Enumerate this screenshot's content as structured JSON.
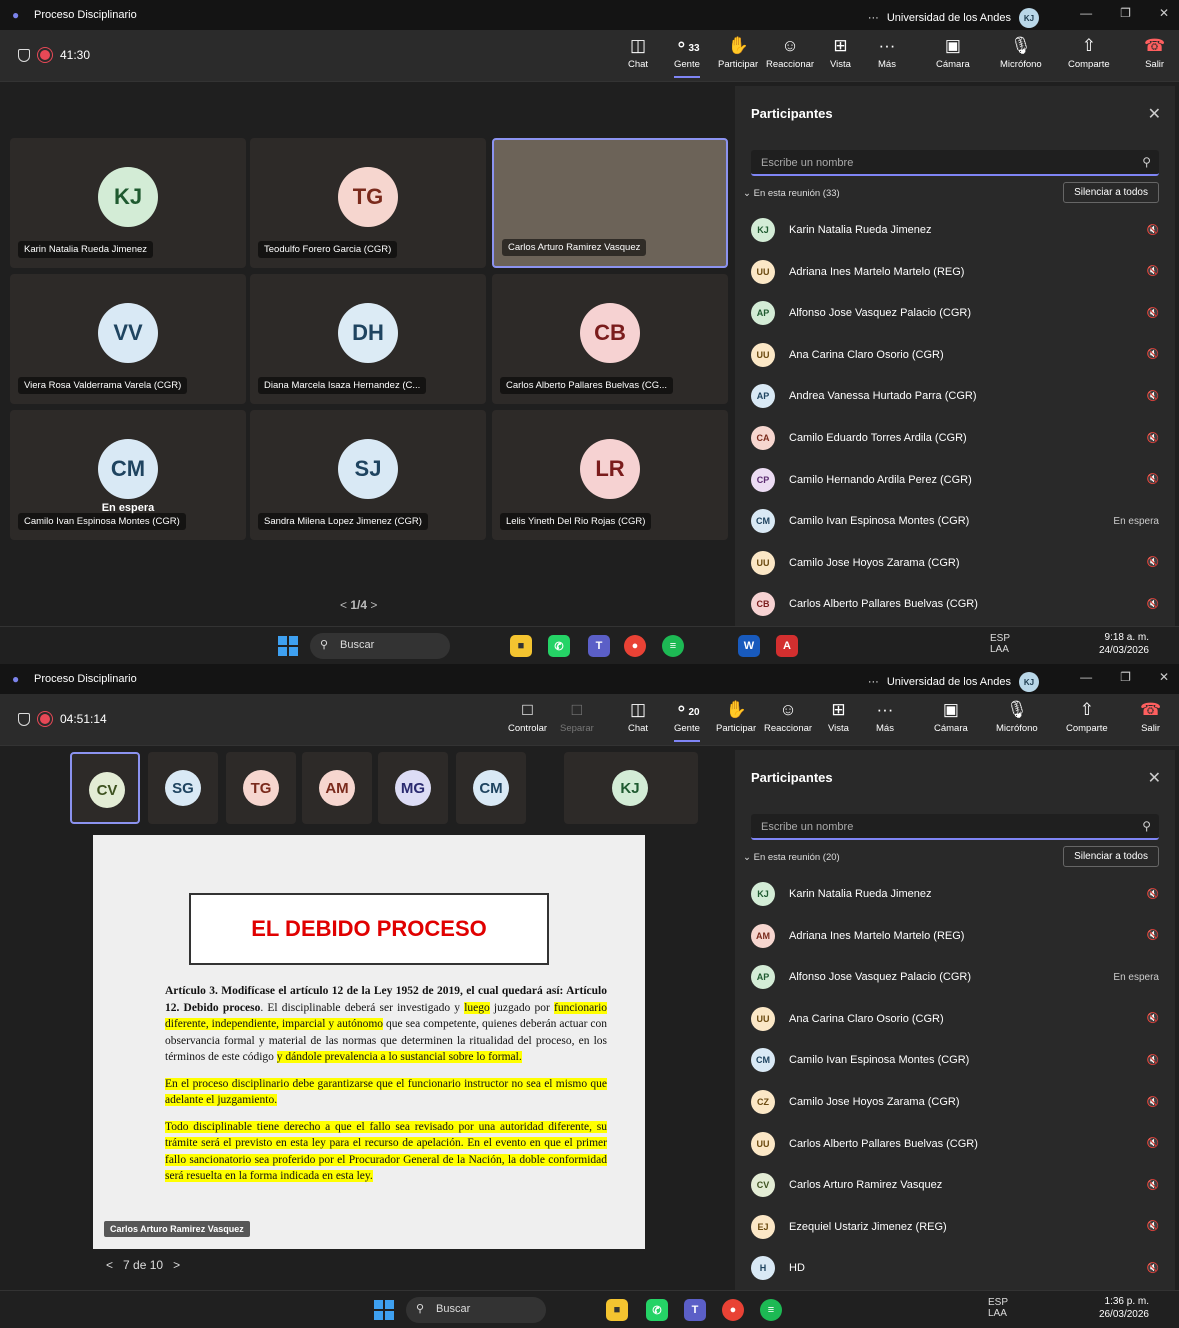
{
  "shot1": {
    "title": "Proceso Disciplinario",
    "org": "Universidad de los Andes",
    "org_avatar": "KJ",
    "timer": "41:30",
    "toolbar": {
      "chat": "Chat",
      "people": "Gente",
      "people_count": "33",
      "raise": "Participar",
      "react": "Reaccionar",
      "view": "Vista",
      "more": "Más",
      "camera": "Cámara",
      "mic": "Micrófono",
      "share": "Comparte",
      "leave": "Salir"
    },
    "tiles": [
      {
        "initials": "KJ",
        "name": "Karin Natalia Rueda Jimenez",
        "color": "#d3ecd6",
        "fg": "#1f5a30"
      },
      {
        "initials": "TG",
        "name": "Teodulfo Forero Garcia (CGR)",
        "color": "#f6d6cf",
        "fg": "#7a2a1c"
      },
      {
        "initials": "",
        "name": "Carlos Arturo Ramirez Vasquez",
        "color": "",
        "fg": ""
      },
      {
        "initials": "VV",
        "name": "Viera Rosa Valderrama Varela (CGR)",
        "color": "#d9e9f5",
        "fg": "#1f4460"
      },
      {
        "initials": "DH",
        "name": "Diana Marcela Isaza Hernandez (C...",
        "color": "#dcebf5",
        "fg": "#1f4460"
      },
      {
        "initials": "CB",
        "name": "Carlos Alberto Pallares Buelvas (CG...",
        "color": "#f6d2d2",
        "fg": "#7a1c1c"
      },
      {
        "initials": "CM",
        "name": "Camilo Ivan Espinosa Montes (CGR)",
        "color": "#d9e9f5",
        "fg": "#1f4460",
        "status": "En espera"
      },
      {
        "initials": "SJ",
        "name": "Sandra Milena Lopez Jimenez (CGR)",
        "color": "#d9e9f5",
        "fg": "#1f4460"
      },
      {
        "initials": "LR",
        "name": "Lelis Yineth Del Rio Rojas (CGR)",
        "color": "#f6d2d2",
        "fg": "#7a1c1c"
      }
    ],
    "pager": "1/4",
    "panel": {
      "title": "Participantes",
      "search_placeholder": "Escribe un nombre",
      "section": "En esta reunión (33)",
      "mute_all": "Silenciar a todos",
      "rows": [
        {
          "initials": "KJ",
          "name": "Karin Natalia Rueda Jimenez",
          "color": "#d3ecd6",
          "fg": "#1f5a30",
          "status": ""
        },
        {
          "initials": "UU",
          "name": "Adriana Ines Martelo Martelo (REG)",
          "color": "#fbe7c6",
          "fg": "#6b4a10",
          "status": ""
        },
        {
          "initials": "AP",
          "name": "Alfonso Jose Vasquez Palacio (CGR)",
          "color": "#d3ecd6",
          "fg": "#1f5a30",
          "status": ""
        },
        {
          "initials": "UU",
          "name": "Ana Carina Claro Osorio (CGR)",
          "color": "#fbe7c6",
          "fg": "#6b4a10",
          "status": ""
        },
        {
          "initials": "AP",
          "name": "Andrea Vanessa Hurtado Parra (CGR)",
          "color": "#d9e9f5",
          "fg": "#1f4460",
          "status": ""
        },
        {
          "initials": "CA",
          "name": "Camilo Eduardo Torres Ardila (CGR)",
          "color": "#f6d6cf",
          "fg": "#7a2a1c",
          "status": ""
        },
        {
          "initials": "CP",
          "name": "Camilo Hernando Ardila Perez (CGR)",
          "color": "#ecdcf3",
          "fg": "#5a2a70",
          "status": ""
        },
        {
          "initials": "CM",
          "name": "Camilo Ivan Espinosa Montes (CGR)",
          "color": "#d9e9f5",
          "fg": "#1f4460",
          "status": "En espera"
        },
        {
          "initials": "UU",
          "name": "Camilo Jose Hoyos Zarama (CGR)",
          "color": "#fbe7c6",
          "fg": "#6b4a10",
          "status": ""
        },
        {
          "initials": "CB",
          "name": "Carlos Alberto Pallares Buelvas (CGR)",
          "color": "#f6d2d2",
          "fg": "#7a1c1c",
          "status": ""
        }
      ]
    },
    "taskbar": {
      "search": "Buscar",
      "lang": "ESP",
      "lang2": "LAA",
      "time": "9:18 a. m.",
      "date": "24/03/2026"
    }
  },
  "shot2": {
    "title": "Proceso Disciplinario",
    "org": "Universidad de los Andes",
    "org_avatar": "KJ",
    "timer": "04:51:14",
    "toolbar": {
      "control": "Controlar",
      "separate": "Separar",
      "chat": "Chat",
      "people": "Gente",
      "people_count": "20",
      "raise": "Participar",
      "react": "Reaccionar",
      "view": "Vista",
      "more": "Más",
      "camera": "Cámara",
      "mic": "Micrófono",
      "share": "Comparte",
      "leave": "Salir"
    },
    "thumbs": [
      {
        "initials": "CV",
        "color": "#e3ecd5",
        "fg": "#3e5220"
      },
      {
        "initials": "SG",
        "color": "#d9e9f5",
        "fg": "#1f4460"
      },
      {
        "initials": "TG",
        "color": "#f6d6cf",
        "fg": "#7a2a1c"
      },
      {
        "initials": "AM",
        "color": "#f6d6cf",
        "fg": "#7a2a1c"
      },
      {
        "initials": "MG",
        "color": "#dcdcf5",
        "fg": "#2a2a70"
      },
      {
        "initials": "CM",
        "color": "#d9e9f5",
        "fg": "#1f4460"
      },
      {
        "initials": "KJ",
        "color": "#d3ecd6",
        "fg": "#1f5a30"
      }
    ],
    "slide": {
      "heading": "EL DEBIDO PROCESO",
      "p1_bold": "Artículo 3. Modifícase el artículo 12 de la Ley 1952 de 2019, el cual quedará así: Artículo 12. Debido proceso",
      "p1_a": ". El disciplinable deberá ser investigado y ",
      "p1_hl1": "luego",
      "p1_b": " juzgado por ",
      "p1_hl2": "funcionario diferente, independiente, imparcial y autónomo",
      "p1_c": " que sea competente, quienes deberán actuar con observancia formal y material de las normas que determinen la ritualidad del proceso, en los términos de este código ",
      "p1_hl3": "y dándole prevalencia a lo sustancial sobre lo formal.",
      "p2": " En el proceso disciplinario debe garantizarse que el funcionario instructor no sea el mismo que adelante el juzgamiento.",
      "p3": "Todo disciplinable tiene derecho a que el fallo sea revisado por una autoridad diferente, su trámite será el previsto en esta ley para el recurso de apelación. En el evento en que el primer fallo sancionatorio sea proferido por el Procurador General de la Nación, la doble conformidad será resuelta en la forma indicada en esta ley."
    },
    "speaker": "Carlos Arturo Ramirez Vasquez",
    "slide_nav": "7 de 10",
    "panel": {
      "title": "Participantes",
      "search_placeholder": "Escribe un nombre",
      "section": "En esta reunión (20)",
      "mute_all": "Silenciar a todos",
      "rows": [
        {
          "initials": "KJ",
          "name": "Karin Natalia Rueda Jimenez",
          "color": "#d3ecd6",
          "fg": "#1f5a30",
          "status": ""
        },
        {
          "initials": "AM",
          "name": "Adriana Ines Martelo Martelo (REG)",
          "color": "#f6d6cf",
          "fg": "#7a2a1c",
          "status": ""
        },
        {
          "initials": "AP",
          "name": "Alfonso Jose Vasquez Palacio (CGR)",
          "color": "#d3ecd6",
          "fg": "#1f5a30",
          "status": "En espera"
        },
        {
          "initials": "UU",
          "name": "Ana Carina Claro Osorio (CGR)",
          "color": "#fbe7c6",
          "fg": "#6b4a10",
          "status": ""
        },
        {
          "initials": "CM",
          "name": "Camilo Ivan Espinosa Montes (CGR)",
          "color": "#d9e9f5",
          "fg": "#1f4460",
          "status": ""
        },
        {
          "initials": "CZ",
          "name": "Camilo Jose Hoyos Zarama (CGR)",
          "color": "#fbe7c6",
          "fg": "#6b4a10",
          "status": ""
        },
        {
          "initials": "UU",
          "name": "Carlos Alberto Pallares Buelvas (CGR)",
          "color": "#fbe7c6",
          "fg": "#6b4a10",
          "status": ""
        },
        {
          "initials": "CV",
          "name": "Carlos Arturo Ramirez Vasquez",
          "color": "#e3ecd5",
          "fg": "#3e5220",
          "status": ""
        },
        {
          "initials": "EJ",
          "name": "Ezequiel Ustariz Jimenez (REG)",
          "color": "#fbe7c6",
          "fg": "#6b4a10",
          "status": ""
        },
        {
          "initials": "H",
          "name": "HD",
          "color": "#d9e9f5",
          "fg": "#1f4460",
          "status": ""
        }
      ]
    },
    "taskbar": {
      "search": "Buscar",
      "lang": "ESP",
      "lang2": "LAA",
      "time": "1:36 p. m.",
      "date": "26/03/2026"
    }
  }
}
